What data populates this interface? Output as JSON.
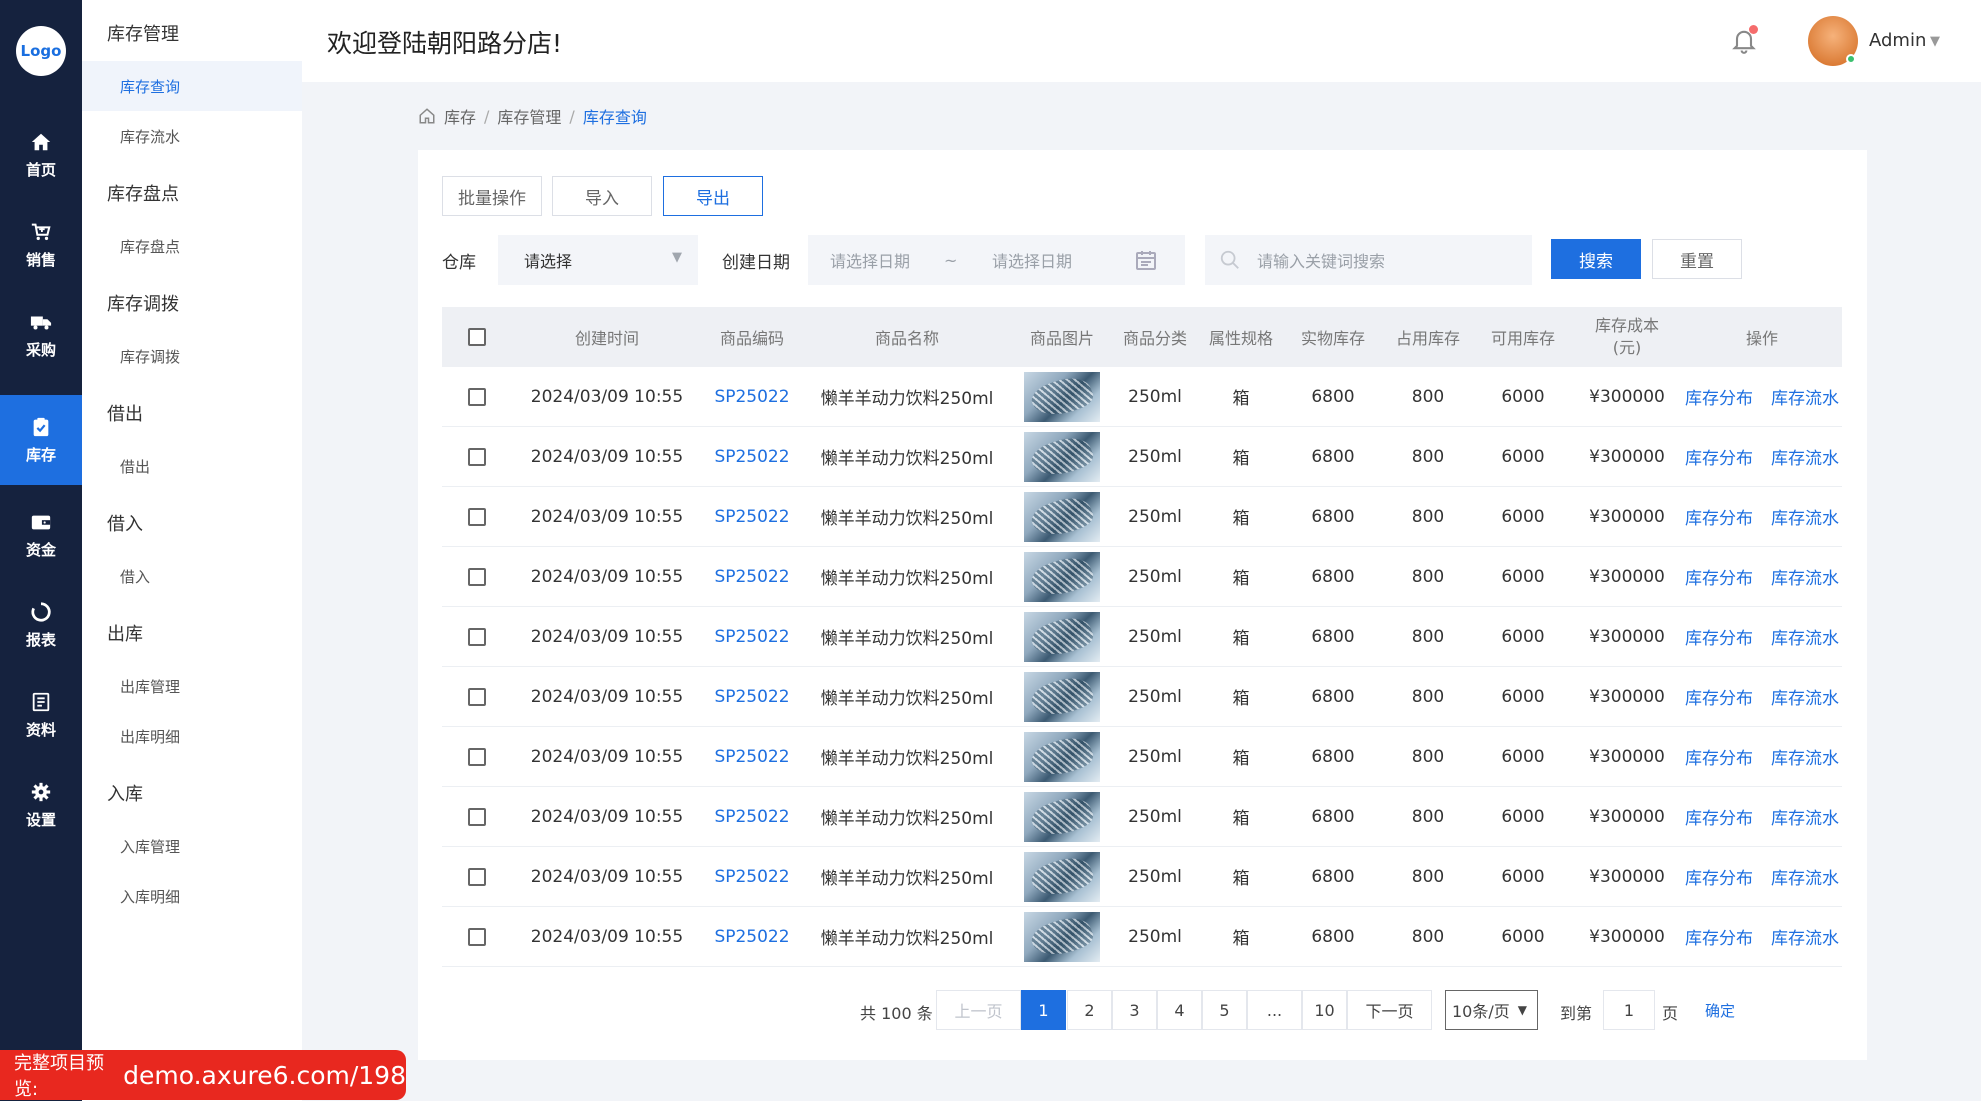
{
  "logo": "Logo",
  "rail": [
    {
      "label": "首页",
      "icon": "home-icon"
    },
    {
      "label": "销售",
      "icon": "cart-icon"
    },
    {
      "label": "采购",
      "icon": "truck-icon"
    },
    {
      "label": "库存",
      "icon": "clipboard-check-icon",
      "active": true
    },
    {
      "label": "资金",
      "icon": "wallet-icon"
    },
    {
      "label": "报表",
      "icon": "loading-ring-icon"
    },
    {
      "label": "资料",
      "icon": "document-icon"
    },
    {
      "label": "设置",
      "icon": "gear-icon"
    }
  ],
  "submenu": {
    "g1": "库存管理",
    "g1_i1": "库存查询",
    "g1_i2": "库存流水",
    "g2": "库存盘点",
    "g2_i1": "库存盘点",
    "g3": "库存调拨",
    "g3_i1": "库存调拨",
    "g4": "借出",
    "g4_i1": "借出",
    "g5": "借入",
    "g5_i1": "借入",
    "g6": "出库",
    "g6_i1": "出库管理",
    "g6_i2": "出库明细",
    "g7": "入库",
    "g7_i1": "入库管理",
    "g7_i2": "入库明细"
  },
  "header": {
    "welcome": "欢迎登陆朝阳路分店!",
    "user": "Admin"
  },
  "breadcrumb": [
    "库存",
    "库存管理",
    "库存查询"
  ],
  "toolbar": {
    "batch": "批量操作",
    "import": "导入",
    "export": "导出"
  },
  "filters": {
    "warehouse_label": "仓库",
    "warehouse_value": "请选择",
    "date_label": "创建日期",
    "date_start_ph": "请选择日期",
    "date_sep": "~",
    "date_end_ph": "请选择日期",
    "keyword_ph": "请输入关键词搜索",
    "search": "搜索",
    "reset": "重置"
  },
  "table": {
    "headers": {
      "created": "创建时间",
      "code": "商品编码",
      "name": "商品名称",
      "image": "商品图片",
      "category": "商品分类",
      "spec": "属性规格",
      "physical": "实物库存",
      "occupied": "占用库存",
      "available": "可用库存",
      "cost_line1": "库存成本",
      "cost_line2": "(元)",
      "ops": "操作"
    },
    "rows": [
      {
        "created": "2024/03/09 10:55",
        "code": "SP25022",
        "name": "懒羊羊动力饮料250ml",
        "category": "250ml",
        "spec": "箱",
        "physical": "6800",
        "occupied": "800",
        "available": "6000",
        "cost": "¥300000",
        "op1": "库存分布",
        "op2": "库存流水"
      },
      {
        "created": "2024/03/09 10:55",
        "code": "SP25022",
        "name": "懒羊羊动力饮料250ml",
        "category": "250ml",
        "spec": "箱",
        "physical": "6800",
        "occupied": "800",
        "available": "6000",
        "cost": "¥300000",
        "op1": "库存分布",
        "op2": "库存流水"
      },
      {
        "created": "2024/03/09 10:55",
        "code": "SP25022",
        "name": "懒羊羊动力饮料250ml",
        "category": "250ml",
        "spec": "箱",
        "physical": "6800",
        "occupied": "800",
        "available": "6000",
        "cost": "¥300000",
        "op1": "库存分布",
        "op2": "库存流水"
      },
      {
        "created": "2024/03/09 10:55",
        "code": "SP25022",
        "name": "懒羊羊动力饮料250ml",
        "category": "250ml",
        "spec": "箱",
        "physical": "6800",
        "occupied": "800",
        "available": "6000",
        "cost": "¥300000",
        "op1": "库存分布",
        "op2": "库存流水"
      },
      {
        "created": "2024/03/09 10:55",
        "code": "SP25022",
        "name": "懒羊羊动力饮料250ml",
        "category": "250ml",
        "spec": "箱",
        "physical": "6800",
        "occupied": "800",
        "available": "6000",
        "cost": "¥300000",
        "op1": "库存分布",
        "op2": "库存流水"
      },
      {
        "created": "2024/03/09 10:55",
        "code": "SP25022",
        "name": "懒羊羊动力饮料250ml",
        "category": "250ml",
        "spec": "箱",
        "physical": "6800",
        "occupied": "800",
        "available": "6000",
        "cost": "¥300000",
        "op1": "库存分布",
        "op2": "库存流水"
      },
      {
        "created": "2024/03/09 10:55",
        "code": "SP25022",
        "name": "懒羊羊动力饮料250ml",
        "category": "250ml",
        "spec": "箱",
        "physical": "6800",
        "occupied": "800",
        "available": "6000",
        "cost": "¥300000",
        "op1": "库存分布",
        "op2": "库存流水"
      },
      {
        "created": "2024/03/09 10:55",
        "code": "SP25022",
        "name": "懒羊羊动力饮料250ml",
        "category": "250ml",
        "spec": "箱",
        "physical": "6800",
        "occupied": "800",
        "available": "6000",
        "cost": "¥300000",
        "op1": "库存分布",
        "op2": "库存流水"
      },
      {
        "created": "2024/03/09 10:55",
        "code": "SP25022",
        "name": "懒羊羊动力饮料250ml",
        "category": "250ml",
        "spec": "箱",
        "physical": "6800",
        "occupied": "800",
        "available": "6000",
        "cost": "¥300000",
        "op1": "库存分布",
        "op2": "库存流水"
      },
      {
        "created": "2024/03/09 10:55",
        "code": "SP25022",
        "name": "懒羊羊动力饮料250ml",
        "category": "250ml",
        "spec": "箱",
        "physical": "6800",
        "occupied": "800",
        "available": "6000",
        "cost": "¥300000",
        "op1": "库存分布",
        "op2": "库存流水"
      }
    ]
  },
  "pagination": {
    "total": "共 100 条",
    "prev": "上一页",
    "pages": [
      "1",
      "2",
      "3",
      "4",
      "5",
      "...",
      "10"
    ],
    "next": "下一页",
    "page_size": "10条/页",
    "goto": "到第",
    "goto_value": "1",
    "page_unit": "页",
    "confirm": "确定"
  },
  "watermark": {
    "prefix": "完整项目预览:",
    "url": "demo.axure6.com/198"
  },
  "colors": {
    "accent": "#1e6fe0",
    "rail": "#15223e",
    "watermark": "#e8281f"
  }
}
